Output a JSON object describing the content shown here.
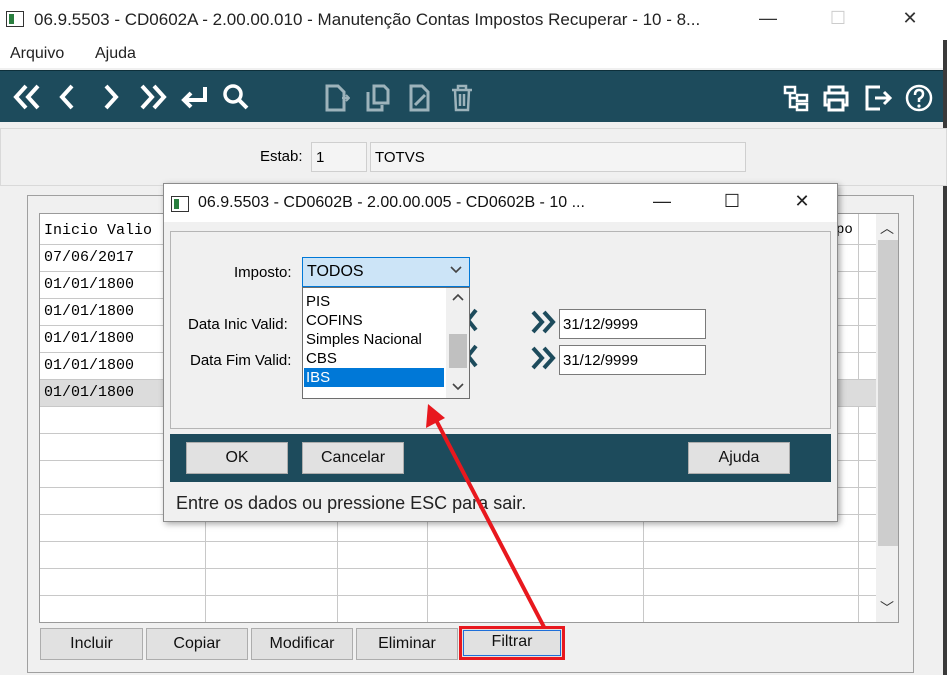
{
  "window": {
    "title": "06.9.5503 - CD0602A - 2.00.00.010 - Manutenção Contas Impostos Recuperar - 10 - 8...",
    "minimize": "—",
    "maximize": "☐",
    "close": "✕"
  },
  "menu": {
    "items": [
      "Arquivo",
      "Ajuda"
    ]
  },
  "toolbar": {
    "nav_icons": [
      "first-icon",
      "prev-icon",
      "next-icon",
      "last-icon",
      "goto-icon",
      "search-icon"
    ],
    "edit_icons": [
      "new-doc-icon",
      "copy-doc-icon",
      "edit-doc-icon",
      "delete-icon"
    ],
    "right_icons": [
      "tree-icon",
      "print-icon",
      "exit-icon",
      "help-icon"
    ]
  },
  "estab": {
    "label": "Estab:",
    "code": "1",
    "name": "TOTVS"
  },
  "grid": {
    "header": "Inicio Valio",
    "header_right": "po",
    "rows": [
      "07/06/2017",
      "01/01/1800",
      "01/01/1800",
      "01/01/1800",
      "01/01/1800",
      "01/01/1800"
    ],
    "scroll_up": "︿",
    "scroll_down": "﹀"
  },
  "buttons": {
    "incluir": "Incluir",
    "copiar": "Copiar",
    "modificar": "Modificar",
    "eliminar": "Eliminar",
    "filtrar": "Filtrar"
  },
  "dialog": {
    "title": "06.9.5503 - CD0602B - 2.00.00.005 - CD0602B - 10 ...",
    "minimize": "—",
    "maximize": "☐",
    "close": "✕",
    "imposto_label": "Imposto:",
    "imposto_value": "TODOS",
    "options": [
      "PIS",
      "COFINS",
      "Simples Nacional",
      "CBS",
      "IBS"
    ],
    "selected_option": "IBS",
    "data_inic_label": "Data Inic Valid:",
    "data_fim_label": "Data Fim Valid:",
    "data_inic_to": "31/12/9999",
    "data_fim_to": "31/12/9999",
    "ok": "OK",
    "cancelar": "Cancelar",
    "ajuda": "Ajuda",
    "status": "Entre os dados ou pressione ESC para sair."
  },
  "colors": {
    "toolbar_bg": "#1d4b5c",
    "selection": "#0078d7",
    "annotation": "#e8181e"
  }
}
